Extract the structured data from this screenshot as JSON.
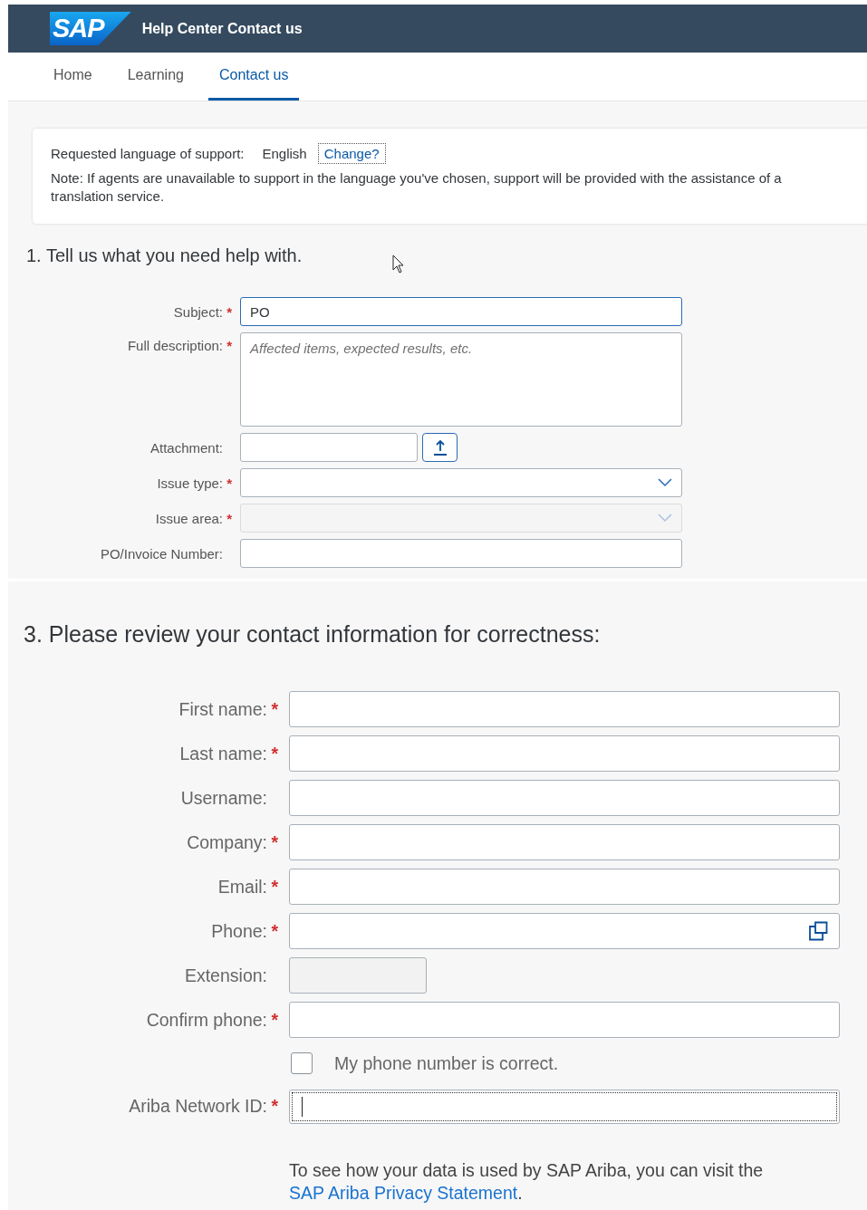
{
  "header": {
    "logo": "SAP",
    "title": "Help Center Contact us"
  },
  "nav": [
    {
      "label": "Home",
      "selected": false
    },
    {
      "label": "Learning",
      "selected": false
    },
    {
      "label": "Contact us",
      "selected": true
    }
  ],
  "language": {
    "label": "Requested language of support:",
    "value": "English",
    "link": "Change?",
    "note": "Note: If agents are unavailable to support in the language you've chosen, support will be provided with the assistance of a translation service."
  },
  "section_1": {
    "heading": "1. Tell us what you need help with.",
    "fields": [
      {
        "kind": "text",
        "label": "Subject:",
        "mark": "*",
        "value": "PO",
        "focused": true
      },
      {
        "kind": "textarea",
        "label": "Full description:",
        "mark": "*",
        "placeholder": "Affected items, expected results, etc."
      },
      {
        "kind": "file",
        "label": "Attachment:"
      },
      {
        "kind": "select",
        "label": "Issue type:",
        "mark": "*",
        "disabled": false
      },
      {
        "kind": "select",
        "label": "Issue area:",
        "mark": "*",
        "disabled": true
      },
      {
        "kind": "text",
        "label": "PO/Invoice Number:"
      }
    ]
  },
  "section_3": {
    "heading": "3. Please review your contact information for correctness:",
    "fields": [
      {
        "kind": "text",
        "label": "First name:",
        "mark": "*"
      },
      {
        "kind": "text",
        "label": "Last name:",
        "mark": "*"
      },
      {
        "kind": "text",
        "label": "Username:"
      },
      {
        "kind": "text",
        "label": "Company:",
        "mark": "*"
      },
      {
        "kind": "text",
        "label": "Email:",
        "mark": "*"
      },
      {
        "kind": "phone",
        "label": "Phone:",
        "mark": "*"
      },
      {
        "kind": "short",
        "label": "Extension:",
        "disabled": true
      },
      {
        "kind": "text",
        "label": "Confirm phone:",
        "mark": "*"
      },
      {
        "kind": "checkbox",
        "label": "My phone number is correct.",
        "checked": false
      },
      {
        "kind": "text",
        "label": "Ariba Network ID:",
        "mark": "*",
        "focused": true
      }
    ],
    "privacy_text": "To see how your data is used by SAP Ariba, you can visit the",
    "privacy_link": "SAP Ariba Privacy Statement",
    "privacy_end": "."
  }
}
